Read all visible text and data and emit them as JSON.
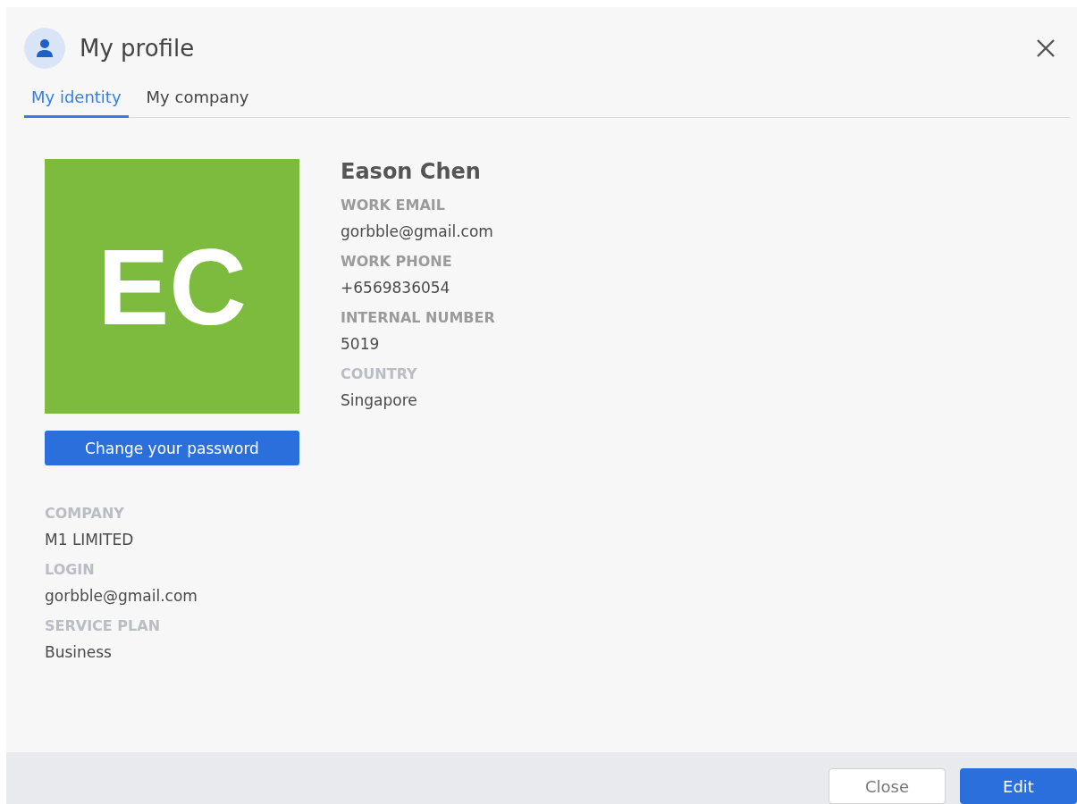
{
  "dialog": {
    "title": "My profile"
  },
  "tabs": [
    {
      "label": "My identity",
      "selected": true
    },
    {
      "label": "My company",
      "selected": false
    }
  ],
  "avatar": {
    "initials": "EC",
    "color": "#7cbb3e"
  },
  "password_button": "Change your password",
  "name": "Eason Chen",
  "details": [
    {
      "label": "WORK EMAIL",
      "value": "gorbble@gmail.com",
      "dim": false
    },
    {
      "label": "WORK PHONE",
      "value": "+6569836054",
      "dim": false
    },
    {
      "label": "INTERNAL NUMBER",
      "value": "5019",
      "dim": false
    },
    {
      "label": "COUNTRY",
      "value": "Singapore",
      "dim": true
    }
  ],
  "account": [
    {
      "label": "COMPANY",
      "value": "M1 LIMITED",
      "dim": true
    },
    {
      "label": "LOGIN",
      "value": "gorbble@gmail.com",
      "dim": true
    },
    {
      "label": "SERVICE PLAN",
      "value": "Business",
      "dim": true
    }
  ],
  "buttons": [
    {
      "label": "Close",
      "kind": "secondary"
    },
    {
      "label": "Edit",
      "kind": "primary"
    }
  ]
}
